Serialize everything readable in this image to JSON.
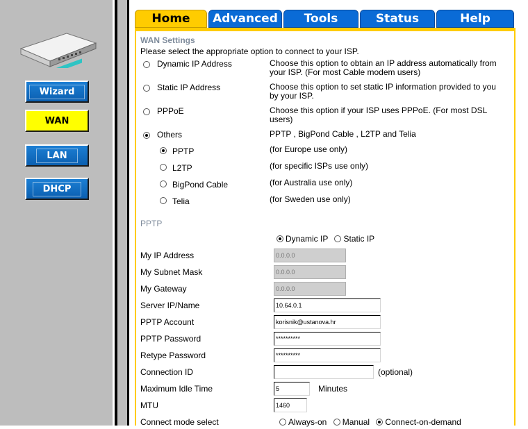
{
  "nav": {
    "wizard": "Wizard",
    "wan": "WAN",
    "lan": "LAN",
    "dhcp": "DHCP"
  },
  "tabs": [
    "Home",
    "Advanced",
    "Tools",
    "Status",
    "Help"
  ],
  "page": {
    "title": "WAN Settings",
    "intro": "Please select the appropriate option to connect to your ISP."
  },
  "options": [
    {
      "label": "Dynamic IP Address",
      "desc": "Choose this option to obtain an IP address automatically from your ISP. (For most Cable modem users)",
      "checked": false
    },
    {
      "label": "Static IP Address",
      "desc": "Choose this option to set static IP information provided to you by your ISP.",
      "checked": false
    },
    {
      "label": "PPPoE",
      "desc": "Choose this option if your ISP uses PPPoE. (For most DSL users)",
      "checked": false
    },
    {
      "label": "Others",
      "desc": "PPTP , BigPond Cable , L2TP and Telia",
      "checked": true
    }
  ],
  "sub_options": [
    {
      "label": "PPTP",
      "desc": "(for Europe use only)",
      "checked": true
    },
    {
      "label": "L2TP",
      "desc": "(for specific ISPs use only)",
      "checked": false
    },
    {
      "label": "BigPond Cable",
      "desc": "(for Australia use only)",
      "checked": false
    },
    {
      "label": "Telia",
      "desc": "(for Sweden use only)",
      "checked": false
    }
  ],
  "pptp": {
    "section_title": "PPTP",
    "ip_mode_dynamic": "Dynamic IP",
    "ip_mode_static": "Static IP",
    "my_ip_label": "My IP Address",
    "my_ip_value": "0.0.0.0",
    "subnet_label": "My Subnet Mask",
    "subnet_value": "0.0.0.0",
    "gateway_label": "My Gateway",
    "gateway_value": "0.0.0.0",
    "server_label": "Server IP/Name",
    "server_value": "10.64.0.1",
    "account_label": "PPTP Account",
    "account_value": "korisnik@ustanova.hr",
    "password_label": "PPTP Password",
    "password_value": "**********",
    "retype_label": "Retype Password",
    "retype_value": "**********",
    "conn_id_label": "Connection ID",
    "conn_id_value": "",
    "conn_id_suffix": "(optional)",
    "idle_label": "Maximum Idle Time",
    "idle_value": "5",
    "idle_suffix": "Minutes",
    "mtu_label": "MTU",
    "mtu_value": "1460",
    "connect_label": "Connect mode select",
    "connect_always": "Always-on",
    "connect_manual": "Manual",
    "connect_demand": "Connect-on-demand"
  },
  "colors": {
    "accent_yellow": "#ffcc00",
    "tab_blue": "#0a6bd6",
    "sidebar_gray": "#bdbdbd",
    "section_gray": "#7f8c9c"
  }
}
